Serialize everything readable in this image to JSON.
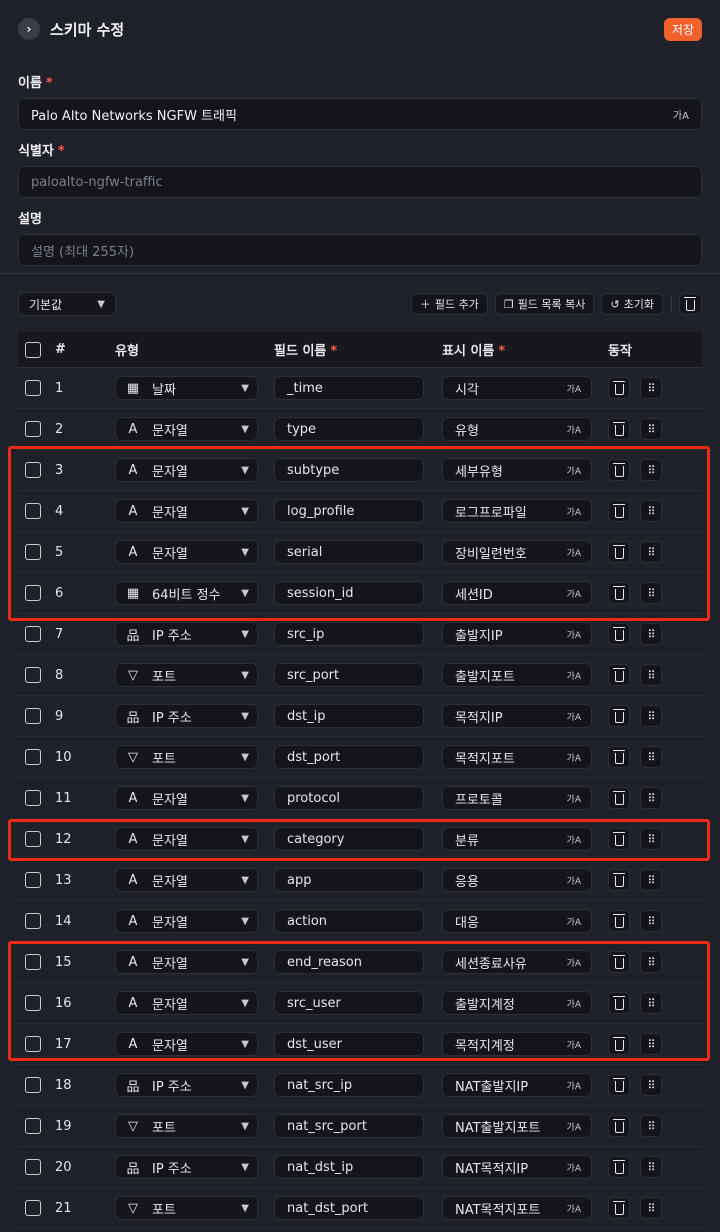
{
  "header": {
    "title": "스키마 수정",
    "save_label": "저장",
    "back_icon": "›"
  },
  "form": {
    "name_label": "이름",
    "name_value": "Palo Alto Networks NGFW 트래픽",
    "id_label": "식별자",
    "id_placeholder": "paloalto-ngfw-traffic",
    "desc_label": "설명",
    "desc_placeholder": "설명 (최대 255자)",
    "required_mark": "*",
    "translate_glyph": "가A"
  },
  "toolbar": {
    "preset_value": "기본값",
    "add_field": "필드 추가",
    "copy_fields": "필드 목록 복사",
    "reset": "초기화"
  },
  "table": {
    "columns": [
      "#",
      "유형",
      "필드 이름",
      "표시 이름",
      "동작"
    ],
    "rows": [
      {
        "n": "1",
        "type": "날짜",
        "icon": "calendar-icon",
        "field": "_time",
        "display": "시각"
      },
      {
        "n": "2",
        "type": "문자열",
        "icon": "text-icon",
        "field": "type",
        "display": "유형"
      },
      {
        "n": "3",
        "type": "문자열",
        "icon": "text-icon",
        "field": "subtype",
        "display": "세부유형"
      },
      {
        "n": "4",
        "type": "문자열",
        "icon": "text-icon",
        "field": "log_profile",
        "display": "로그프로파일"
      },
      {
        "n": "5",
        "type": "문자열",
        "icon": "text-icon",
        "field": "serial",
        "display": "장비일련번호"
      },
      {
        "n": "6",
        "type": "64비트 정수",
        "icon": "calculator-icon",
        "field": "session_id",
        "display": "세션ID"
      },
      {
        "n": "7",
        "type": "IP 주소",
        "icon": "network-icon",
        "field": "src_ip",
        "display": "출발지IP"
      },
      {
        "n": "8",
        "type": "포트",
        "icon": "port-icon",
        "field": "src_port",
        "display": "출발지포트"
      },
      {
        "n": "9",
        "type": "IP 주소",
        "icon": "network-icon",
        "field": "dst_ip",
        "display": "목적지IP"
      },
      {
        "n": "10",
        "type": "포트",
        "icon": "port-icon",
        "field": "dst_port",
        "display": "목적지포트"
      },
      {
        "n": "11",
        "type": "문자열",
        "icon": "text-icon",
        "field": "protocol",
        "display": "프로토콜"
      },
      {
        "n": "12",
        "type": "문자열",
        "icon": "text-icon",
        "field": "category",
        "display": "분류"
      },
      {
        "n": "13",
        "type": "문자열",
        "icon": "text-icon",
        "field": "app",
        "display": "응용"
      },
      {
        "n": "14",
        "type": "문자열",
        "icon": "text-icon",
        "field": "action",
        "display": "대응"
      },
      {
        "n": "15",
        "type": "문자열",
        "icon": "text-icon",
        "field": "end_reason",
        "display": "세션종료사유"
      },
      {
        "n": "16",
        "type": "문자열",
        "icon": "text-icon",
        "field": "src_user",
        "display": "출발지계정"
      },
      {
        "n": "17",
        "type": "문자열",
        "icon": "text-icon",
        "field": "dst_user",
        "display": "목적지계정"
      },
      {
        "n": "18",
        "type": "IP 주소",
        "icon": "network-icon",
        "field": "nat_src_ip",
        "display": "NAT출발지IP"
      },
      {
        "n": "19",
        "type": "포트",
        "icon": "port-icon",
        "field": "nat_src_port",
        "display": "NAT출발지포트"
      },
      {
        "n": "20",
        "type": "IP 주소",
        "icon": "network-icon",
        "field": "nat_dst_ip",
        "display": "NAT목적지IP"
      },
      {
        "n": "21",
        "type": "포트",
        "icon": "port-icon",
        "field": "nat_dst_port",
        "display": "NAT목적지포트"
      }
    ]
  },
  "colors": {
    "accent": "#f2602b",
    "highlight": "#ec2a15",
    "required": "#ff5a4f",
    "bg": "#1f2128"
  }
}
